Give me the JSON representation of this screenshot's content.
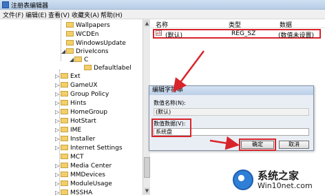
{
  "window": {
    "title": "注册表编辑器"
  },
  "menu": [
    "文件(F)",
    "编辑(E)",
    "查看(V)",
    "收藏夹(A)",
    "帮助(H)"
  ],
  "tree": {
    "items": [
      {
        "label": "Wallpapers"
      },
      {
        "label": "WCDEn"
      },
      {
        "label": "WindowsUpdate"
      },
      {
        "label": "DriveIcons"
      },
      {
        "label": "C"
      },
      {
        "label": "Defaultlabel"
      },
      {
        "label": "Ext"
      },
      {
        "label": "GameUX"
      },
      {
        "label": "Group Policy"
      },
      {
        "label": "Hints"
      },
      {
        "label": "HomeGroup"
      },
      {
        "label": "HotStart"
      },
      {
        "label": "IME"
      },
      {
        "label": "Installer"
      },
      {
        "label": "Internet Settings"
      },
      {
        "label": "MCT"
      },
      {
        "label": "Media Center"
      },
      {
        "label": "MMDevices"
      },
      {
        "label": "ModuleUsage"
      },
      {
        "label": "MSSHA"
      }
    ]
  },
  "list": {
    "columns": [
      "名称",
      "类型",
      "数据"
    ],
    "rows": [
      {
        "name": "(默认)",
        "type": "REG_SZ",
        "data": "(数值未设置)",
        "icon_text": "ab"
      }
    ]
  },
  "dialog": {
    "title": "编辑字符串",
    "name_label": "数值名称(N):",
    "name_value": "(默认)",
    "data_label": "数值数据(V):",
    "data_value": "系统盘",
    "ok": "确定",
    "cancel": "取消"
  },
  "watermark": {
    "line1": "系统之家",
    "line2": "Win10net.com"
  },
  "colors": {
    "highlight": "#d9232a"
  }
}
